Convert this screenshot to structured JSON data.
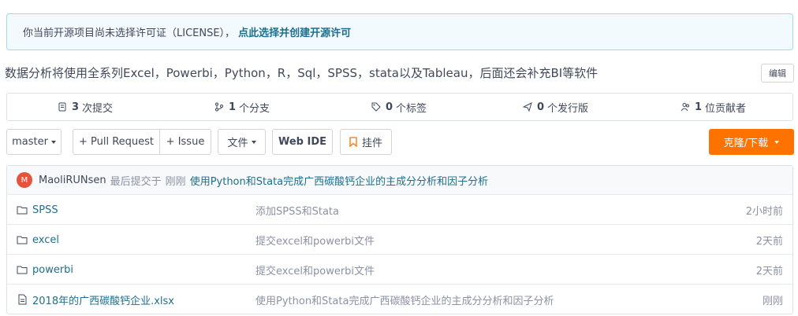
{
  "notice": {
    "text": "你当前开源项目尚未选择许可证（LICENSE），",
    "link": "点此选择并创建开源许可"
  },
  "description": "数据分析将使用全系列Excel，Powerbi，Python，R，Sql，SPSS，stata以及Tableau，后面还会补充BI等软件",
  "edit_label": "编辑",
  "stats": [
    {
      "icon": "commit-icon",
      "count": "3",
      "label": "次提交"
    },
    {
      "icon": "branch-icon",
      "count": "1",
      "label": "个分支"
    },
    {
      "icon": "tag-icon",
      "count": "0",
      "label": "个标签"
    },
    {
      "icon": "release-icon",
      "count": "0",
      "label": "个发行版"
    },
    {
      "icon": "contributors-icon",
      "count": "1",
      "label": "位贡献者"
    }
  ],
  "toolbar": {
    "branch": "master",
    "pull_request": "+ Pull Request",
    "issue": "+ Issue",
    "files": "文件",
    "web_ide": "Web IDE",
    "widget": "挂件",
    "clone": "克隆/下载"
  },
  "last_commit": {
    "avatar_letter": "M",
    "author": "MaoliRUNsen",
    "meta": "最后提交于",
    "time": "刚刚",
    "message": "使用Python和Stata完成广西碳酸钙企业的主成分分析和因子分析"
  },
  "files": [
    {
      "type": "folder",
      "name": "SPSS",
      "message": "添加SPSS和Stata",
      "time": "2小时前"
    },
    {
      "type": "folder",
      "name": "excel",
      "message": "提交excel和powerbi文件",
      "time": "2天前"
    },
    {
      "type": "folder",
      "name": "powerbi",
      "message": "提交excel和powerbi文件",
      "time": "2天前"
    },
    {
      "type": "file",
      "name": "2018年的广西碳酸钙企业.xlsx",
      "message": "使用Python和Stata完成广西碳酸钙企业的主成分分析和因子分析",
      "time": "刚刚"
    }
  ],
  "colors": {
    "accent": "#fe7300",
    "link": "#1e6f8e",
    "avatar": "#e5533d"
  }
}
